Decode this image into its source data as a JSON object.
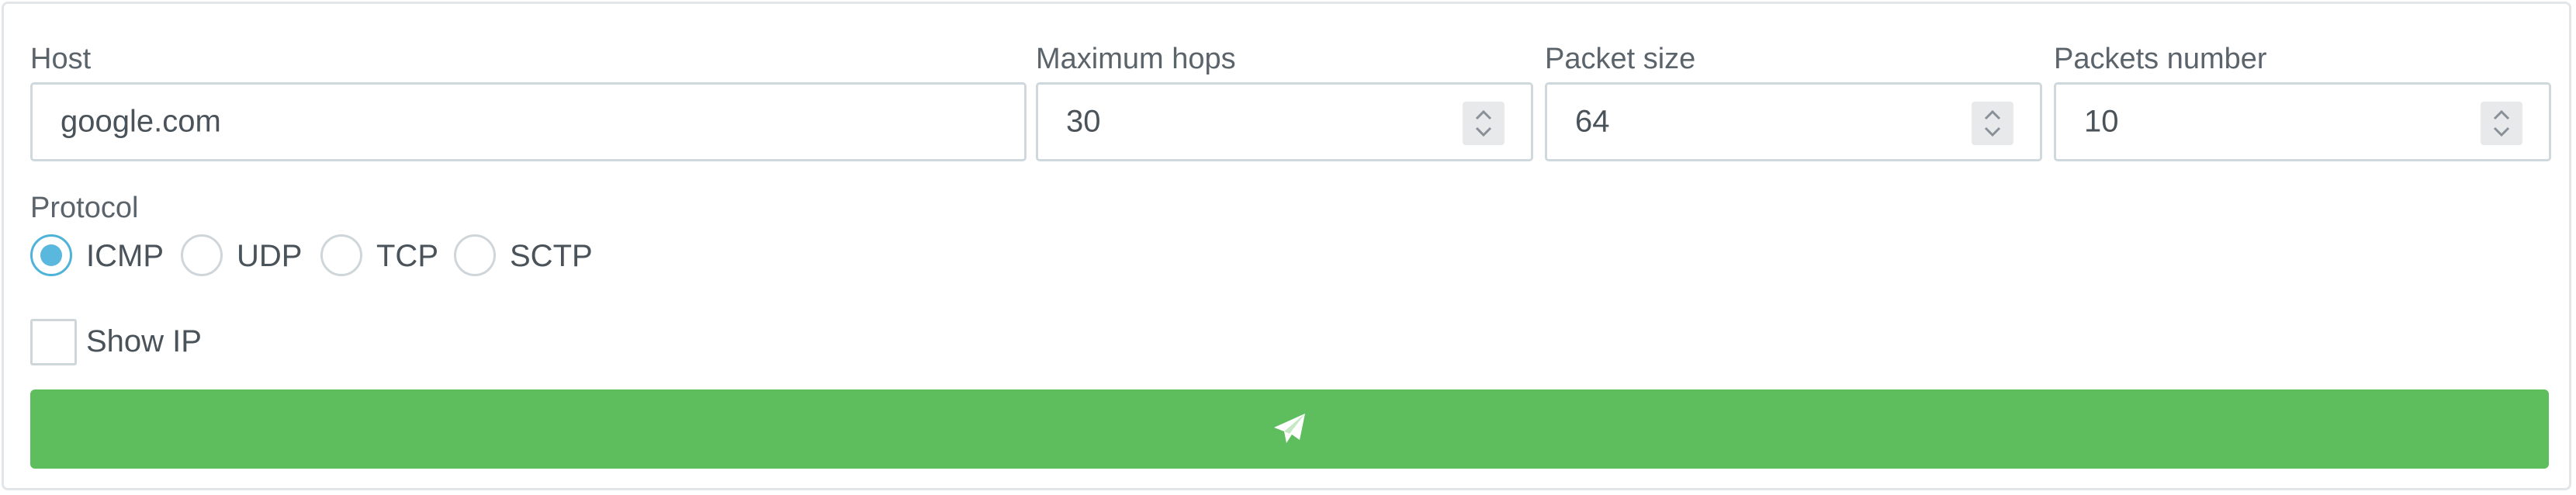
{
  "form": {
    "host": {
      "label": "Host",
      "value": "google.com"
    },
    "max_hops": {
      "label": "Maximum hops",
      "value": "30"
    },
    "packet_size": {
      "label": "Packet size",
      "value": "64"
    },
    "packets_number": {
      "label": "Packets number",
      "value": "10"
    },
    "protocol": {
      "label": "Protocol",
      "options": [
        "ICMP",
        "UDP",
        "TCP",
        "SCTP"
      ],
      "selected": "ICMP"
    },
    "show_ip": {
      "label": "Show IP",
      "checked": false
    },
    "submit": {
      "icon": "paper-plane-icon"
    }
  },
  "colors": {
    "submit_bg": "#5ebe5e",
    "radio_accent": "#5ab7dd",
    "border": "#cfd8dc"
  }
}
